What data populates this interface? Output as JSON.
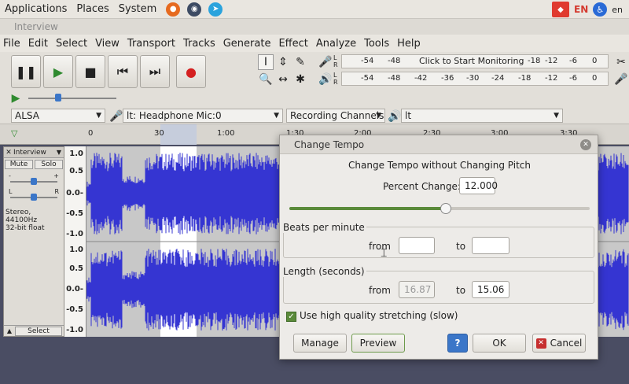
{
  "system_panel": {
    "menus": [
      "Applications",
      "Places",
      "System"
    ],
    "lang": "EN",
    "kb": "en"
  },
  "window": {
    "title": "Interview"
  },
  "menubar": [
    "File",
    "Edit",
    "Select",
    "View",
    "Transport",
    "Tracks",
    "Generate",
    "Effect",
    "Analyze",
    "Tools",
    "Help"
  ],
  "meters": {
    "record_prompt": "Click to Start Monitoring",
    "record_ticks": [
      "-54",
      "-48",
      "-18",
      "-12",
      "-6",
      "0"
    ],
    "play_ticks": [
      "-54",
      "-48",
      "-42",
      "-36",
      "-30",
      "-24",
      "-18",
      "-12",
      "-6",
      "0"
    ],
    "channel_l": "L",
    "channel_r": "R"
  },
  "devices": {
    "host": "ALSA",
    "input": "lt: Headphone Mic:0",
    "channels": "Recording Channels",
    "output": "lt"
  },
  "timeline": {
    "ticks": [
      "0",
      "30",
      "1:00",
      "1:30",
      "2:00",
      "2:30",
      "3:00",
      "3:30"
    ]
  },
  "track": {
    "name": "Interview",
    "mute": "Mute",
    "solo": "Solo",
    "pan_l": "L",
    "pan_r": "R",
    "info_line1": "Stereo, 44100Hz",
    "info_line2": "32-bit float",
    "select": "Select",
    "scale": [
      "1.0",
      "0.5",
      "0.0-",
      "-0.5",
      "-1.0",
      "1.0",
      "0.5",
      "0.0-",
      "-0.5",
      "-1.0"
    ]
  },
  "dialog": {
    "title": "Change Tempo",
    "heading": "Change Tempo without Changing Pitch",
    "percent_label": "Percent Change:",
    "percent_value": "12.000",
    "slider_fraction": 0.52,
    "bpm_group": "Beats per minute",
    "from_label": "from",
    "to_label": "to",
    "bpm_from": "",
    "bpm_to": "",
    "length_group": "Length (seconds)",
    "length_from": "16.87",
    "length_to": "15.06",
    "hq_label": "Use high quality stretching (slow)",
    "manage": "Manage",
    "preview": "Preview",
    "help": "?",
    "ok": "OK",
    "cancel": "Cancel"
  },
  "colors": {
    "waveform": "#3535d2",
    "selection": "#ffffff",
    "accent_green": "#5a8a3a"
  }
}
